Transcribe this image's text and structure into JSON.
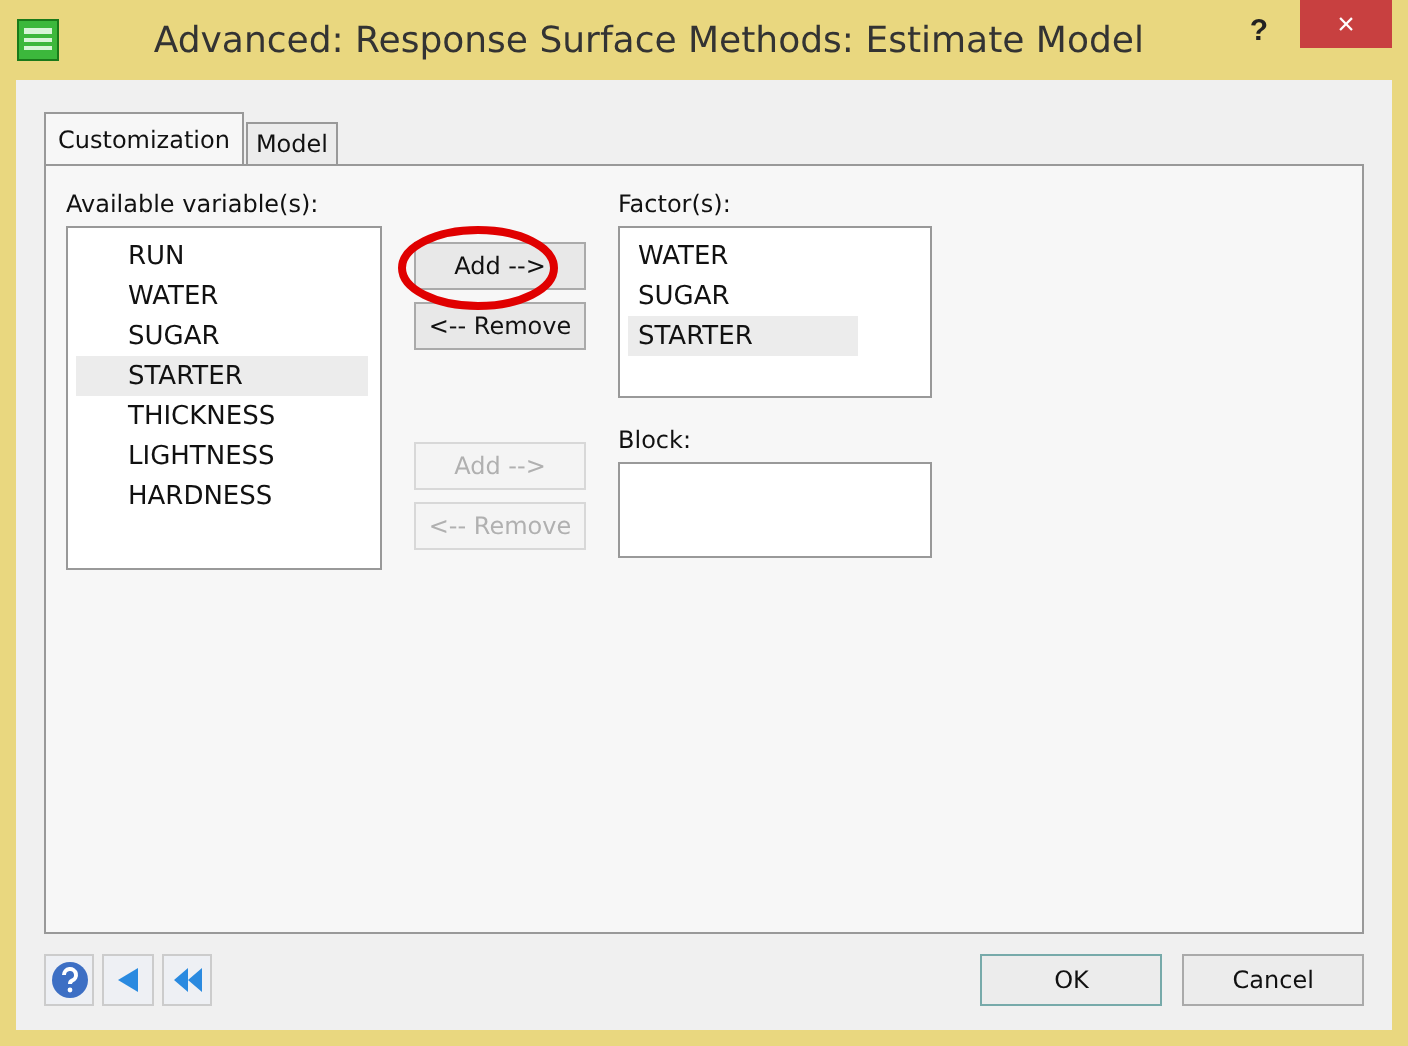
{
  "window": {
    "title": "Advanced: Response Surface Methods: Estimate Model",
    "help": "?",
    "close": "×"
  },
  "tabs": [
    {
      "label": "Customization",
      "selected": true
    },
    {
      "label": "Model",
      "selected": false
    }
  ],
  "available": {
    "label": "Available variable(s):",
    "items": [
      {
        "label": "RUN",
        "selected": false
      },
      {
        "label": "WATER",
        "selected": false
      },
      {
        "label": "SUGAR",
        "selected": false
      },
      {
        "label": "STARTER",
        "selected": true
      },
      {
        "label": "THICKNESS",
        "selected": false
      },
      {
        "label": "LIGHTNESS",
        "selected": false
      },
      {
        "label": "HARDNESS",
        "selected": false
      }
    ]
  },
  "factor_buttons": [
    {
      "label": "Add -->",
      "disabled": false,
      "circled": true
    },
    {
      "label": "<-- Remove",
      "disabled": false,
      "circled": false
    }
  ],
  "factors": {
    "label": "Factor(s):",
    "items": [
      {
        "label": "WATER",
        "selected": false
      },
      {
        "label": "SUGAR",
        "selected": false
      },
      {
        "label": "STARTER",
        "selected": true
      }
    ]
  },
  "block_buttons": [
    {
      "label": "Add -->",
      "disabled": true,
      "circled": false
    },
    {
      "label": "<-- Remove",
      "disabled": true,
      "circled": false
    }
  ],
  "block": {
    "label": "Block:"
  },
  "footer_buttons": [
    {
      "label": "OK",
      "default": true
    },
    {
      "label": "Cancel",
      "default": false
    }
  ]
}
